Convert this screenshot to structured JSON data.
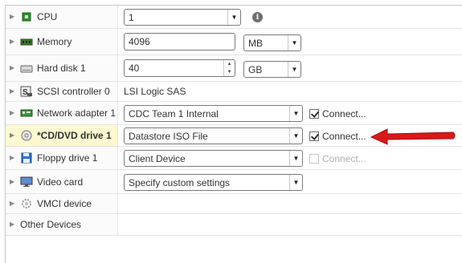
{
  "rows": {
    "cpu": {
      "label": "CPU",
      "value": "1"
    },
    "memory": {
      "label": "Memory",
      "value": "4096",
      "unit": "MB"
    },
    "hard_disk": {
      "label": "Hard disk 1",
      "value": "40",
      "unit": "GB"
    },
    "scsi": {
      "label": "SCSI controller 0",
      "value": "LSI Logic SAS"
    },
    "network": {
      "label": "Network adapter 1",
      "value": "CDC Team 1 Internal",
      "connect_label": "Connect...",
      "connect_checked": true
    },
    "cddvd": {
      "label": "*CD/DVD drive 1",
      "value": "Datastore ISO File",
      "connect_label": "Connect...",
      "connect_checked": true
    },
    "floppy": {
      "label": "Floppy drive 1",
      "value": "Client Device",
      "connect_label": "Connect...",
      "connect_checked": false,
      "connect_enabled": false
    },
    "video": {
      "label": "Video card",
      "value": "Specify custom settings"
    },
    "vmci": {
      "label": "VMCI device"
    },
    "other": {
      "label": "Other Devices"
    }
  },
  "colors": {
    "highlight_row": "#fdf8d0",
    "annotation_arrow": "#d8191a"
  },
  "icons": {
    "cpu": "cpu-chip-icon",
    "memory": "memory-module-icon",
    "hard_disk": "hard-disk-icon",
    "scsi": "scsi-controller-icon",
    "network": "network-adapter-icon",
    "cddvd": "cd-dvd-disc-icon",
    "floppy": "floppy-disk-icon",
    "video": "monitor-icon",
    "vmci": "gear-icon",
    "info": "info-icon"
  }
}
